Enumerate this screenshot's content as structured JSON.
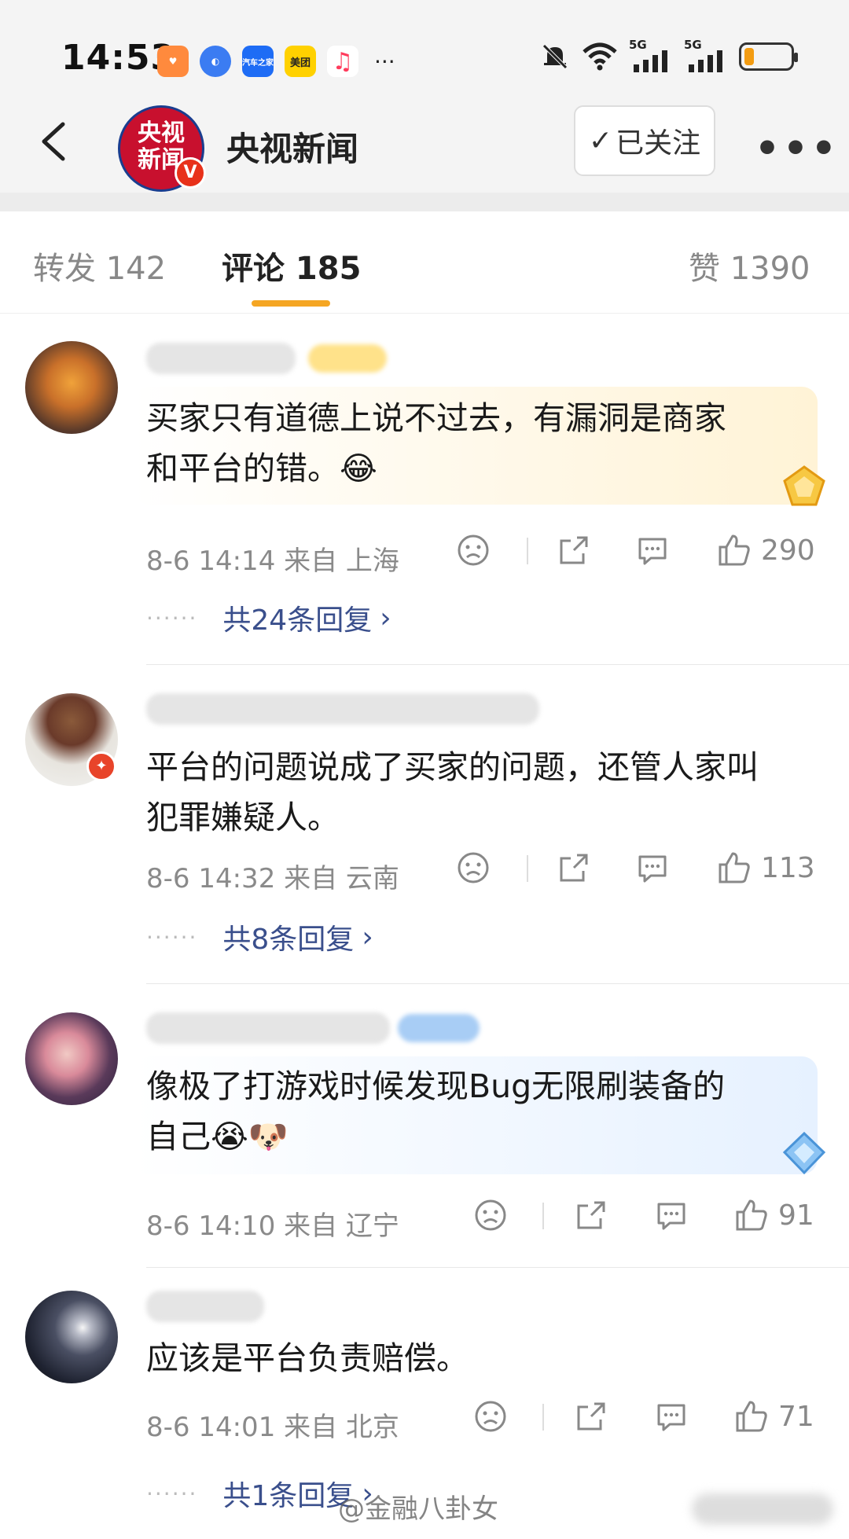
{
  "status_bar": {
    "time": "14:53",
    "apps": [
      {
        "name": "heart-app-icon",
        "color": "#ff8a3d",
        "label": ""
      },
      {
        "name": "browser-app-icon",
        "color": "#3b7cf2",
        "label": ""
      },
      {
        "name": "autohome-app-icon",
        "color": "#1e6cf5",
        "label": "汽车之家"
      },
      {
        "name": "meituan-app-icon",
        "color": "#ffd100",
        "label": "美团"
      },
      {
        "name": "music-app-icon",
        "color": "#ffffff",
        "label": "♫"
      }
    ],
    "more": "···",
    "network": [
      "5G",
      "5G"
    ]
  },
  "header": {
    "channel_avatar_text": "央视\n新闻",
    "channel_name": "央视新闻",
    "follow_label": "已关注",
    "more_label": "•••"
  },
  "tabs": [
    {
      "label": "转发 142",
      "active": false
    },
    {
      "label": "评论 185",
      "active": true
    },
    {
      "label": "赞 1390",
      "active": false
    }
  ],
  "comments": [
    {
      "text": "买家只有道德上说不过去，有漏洞是商家和平台的错。😂",
      "text_lines": [
        "买家只有道德上说不过去，有漏洞是商家",
        "和平台的错。😂"
      ],
      "meta": "8-6 14:14 来自 上海",
      "likes": "290",
      "replies": "共24条回复",
      "bubble_color": "#fff6e0"
    },
    {
      "text": "平台的问题说成了买家的问题，还管人家叫犯罪嫌疑人。",
      "text_lines": [
        "平台的问题说成了买家的问题，还管人家叫",
        "犯罪嫌疑人。"
      ],
      "meta": "8-6 14:32 来自 云南",
      "likes": "113",
      "replies": "共8条回复",
      "bubble_color": ""
    },
    {
      "text": "像极了打游戏时候发现Bug无限刷装备的自己😭🐶",
      "text_lines": [
        "像极了打游戏时候发现Bug无限刷装备的",
        "自己😭🐶"
      ],
      "meta": "8-6 14:10 来自 辽宁",
      "likes": "91",
      "replies": "",
      "bubble_color": "#eaf3ff"
    },
    {
      "text": "应该是平台负责赔偿。",
      "text_lines": [
        "应该是平台负责赔偿。"
      ],
      "meta": "8-6 14:01 来自 北京",
      "likes": "71",
      "replies": "共1条回复",
      "bubble_color": ""
    }
  ],
  "watermark": "@金融八卦女"
}
